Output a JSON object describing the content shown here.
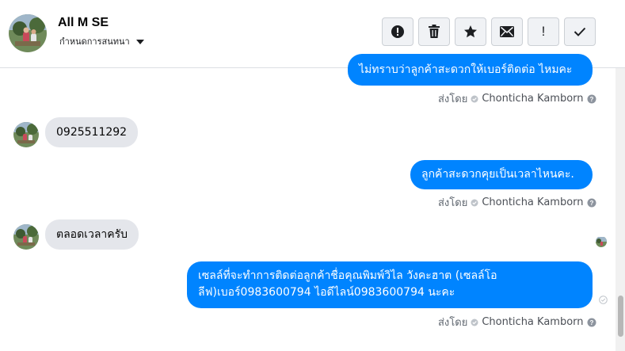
{
  "header": {
    "contact_name": "All M SE",
    "subtitle": "กำหนดการสนทนา",
    "toolbar": [
      {
        "icon": "alert-circle-icon"
      },
      {
        "icon": "trash-icon"
      },
      {
        "icon": "star-icon"
      },
      {
        "icon": "mail-icon"
      },
      {
        "icon": "exclamation-icon",
        "label": "!"
      },
      {
        "icon": "check-icon"
      }
    ]
  },
  "messages": [
    {
      "direction": "outgoing",
      "text": "ไม่ทราบว่าลูกค้าสะดวกให้เบอร์ติดต่อ ไหมคะ",
      "sent_by_prefix": "ส่งโดย",
      "sent_by_name": "Chonticha Kamborn"
    },
    {
      "direction": "incoming",
      "text": "0925511292"
    },
    {
      "direction": "outgoing",
      "text": "ลูกค้าสะดวกคุยเป็นเวลาไหนคะ.",
      "sent_by_prefix": "ส่งโดย",
      "sent_by_name": "Chonticha Kamborn"
    },
    {
      "direction": "incoming",
      "text": "ตลอดเวลาครับ"
    },
    {
      "direction": "outgoing",
      "text_line1": "เซลล์ที่จะทำการติดต่อลูกค้าชื่อคุณพิมพ์วิไล วังคะฮาต (เซลล์โอ",
      "text_line2": "ลีฟ)เบอร์0983600794 ไอดีไลน์0983600794 นะคะ",
      "sent_by_prefix": "ส่งโดย",
      "sent_by_name": "Chonticha Kamborn"
    }
  ],
  "colors": {
    "outgoing_bubble": "#0084ff",
    "incoming_bubble": "#e4e6eb",
    "toolbar_button_bg": "#f0f2f5"
  }
}
